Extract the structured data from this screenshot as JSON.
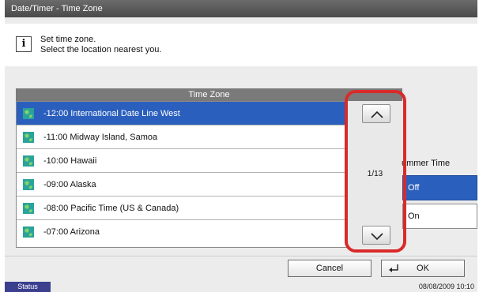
{
  "window": {
    "title": "Date/Timer - Time Zone"
  },
  "message": {
    "icon": "info-icon",
    "line1": "Set time zone.",
    "line2": "Select the location nearest you."
  },
  "timezone_list": {
    "header": "Time Zone",
    "selected_index": 0,
    "items": [
      {
        "label": "-12:00 International Date Line West",
        "icon": "globe-icon"
      },
      {
        "label": "-11:00 Midway Island, Samoa",
        "icon": "globe-icon"
      },
      {
        "label": "-10:00 Hawaii",
        "icon": "globe-icon"
      },
      {
        "label": "-09:00 Alaska",
        "icon": "globe-icon"
      },
      {
        "label": "-08:00 Pacific Time (US & Canada)",
        "icon": "globe-icon"
      },
      {
        "label": "-07:00 Arizona",
        "icon": "globe-icon"
      }
    ],
    "page_indicator": "1/13",
    "scroll_up_icon": "chevron-up-icon",
    "scroll_down_icon": "chevron-down-icon"
  },
  "summer_time": {
    "label": "Summer Time",
    "visible_label": "ummer Time",
    "off_label": "Off",
    "on_label": "On",
    "selected": "Off"
  },
  "buttons": {
    "cancel": "Cancel",
    "ok": "OK",
    "ok_icon": "enter-icon"
  },
  "statusbar": {
    "status_label": "Status",
    "datetime": "08/08/2009   10:10"
  },
  "colors": {
    "selection": "#2b5fbd",
    "highlight": "#d92a2a",
    "titlebar": "#555555"
  }
}
